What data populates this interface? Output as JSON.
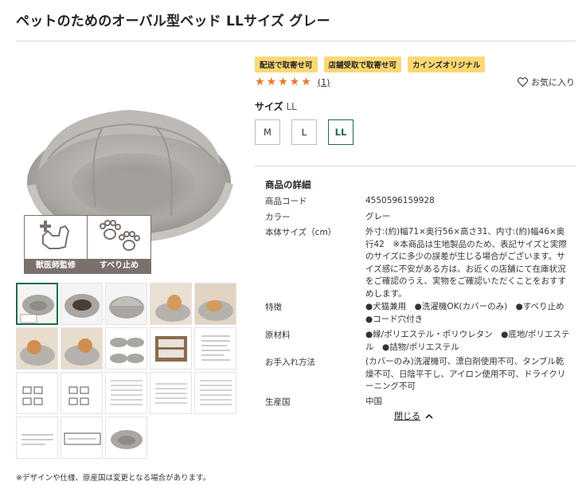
{
  "product": {
    "title": "ペットのためのオーバル型ベッド LLサイズ グレー"
  },
  "badges": {
    "vet": "獣医師監修",
    "nonslip": "すべり止め"
  },
  "tags": [
    "配送で取寄せ可",
    "店舗受取で取寄せ可",
    "カインズオリジナル"
  ],
  "rating": {
    "stars": 5,
    "count": "(1)"
  },
  "favorite_label": "お気に入り",
  "size": {
    "label": "サイズ",
    "selected": "LL",
    "options": [
      "M",
      "L",
      "LL"
    ]
  },
  "details": {
    "title": "商品の詳細",
    "rows": [
      {
        "label": "商品コード",
        "value": "4550596159928"
      },
      {
        "label": "カラー",
        "value": "グレー"
      },
      {
        "label": "本体サイズ（cm）",
        "value": "外寸:(約)幅71×奥行56×高さ31、内寸:(約)幅46×奥行42　※本商品は生地製品のため、表記サイズと実際のサイズに多少の誤差が生じる場合がございます。サイズ感に不安がある方は、お近くの店舗にて在庫状況をご確認のうえ、実物をご確認いただくことをおすすめします。"
      },
      {
        "label": "特徴",
        "value": "●犬猫兼用　●洗濯機OK(カバーのみ)　●すべり止め　●コード穴付き"
      },
      {
        "label": "原材料",
        "value": "●縁/ポリエステル・ポリウレタン　●底地/ポリエステル　●詰物/ポリエステル"
      },
      {
        "label": "お手入れ方法",
        "value": "(カバーのみ)洗濯機可、漂白剤使用不可、タンブル乾燥不可、日陰平干し、アイロン使用不可、ドライクリーニング不可"
      },
      {
        "label": "生産国",
        "value": "中国"
      }
    ]
  },
  "close_label": "閉じる",
  "footnote": "※デザインや仕様、原産国は変更となる場合があります。",
  "colors": {
    "accent": "#1f6b4a",
    "tag_bg": "#fbd873",
    "star": "#e8782a",
    "badge_gray": "#7a716c",
    "bed_gray": "#a9a6a2"
  }
}
